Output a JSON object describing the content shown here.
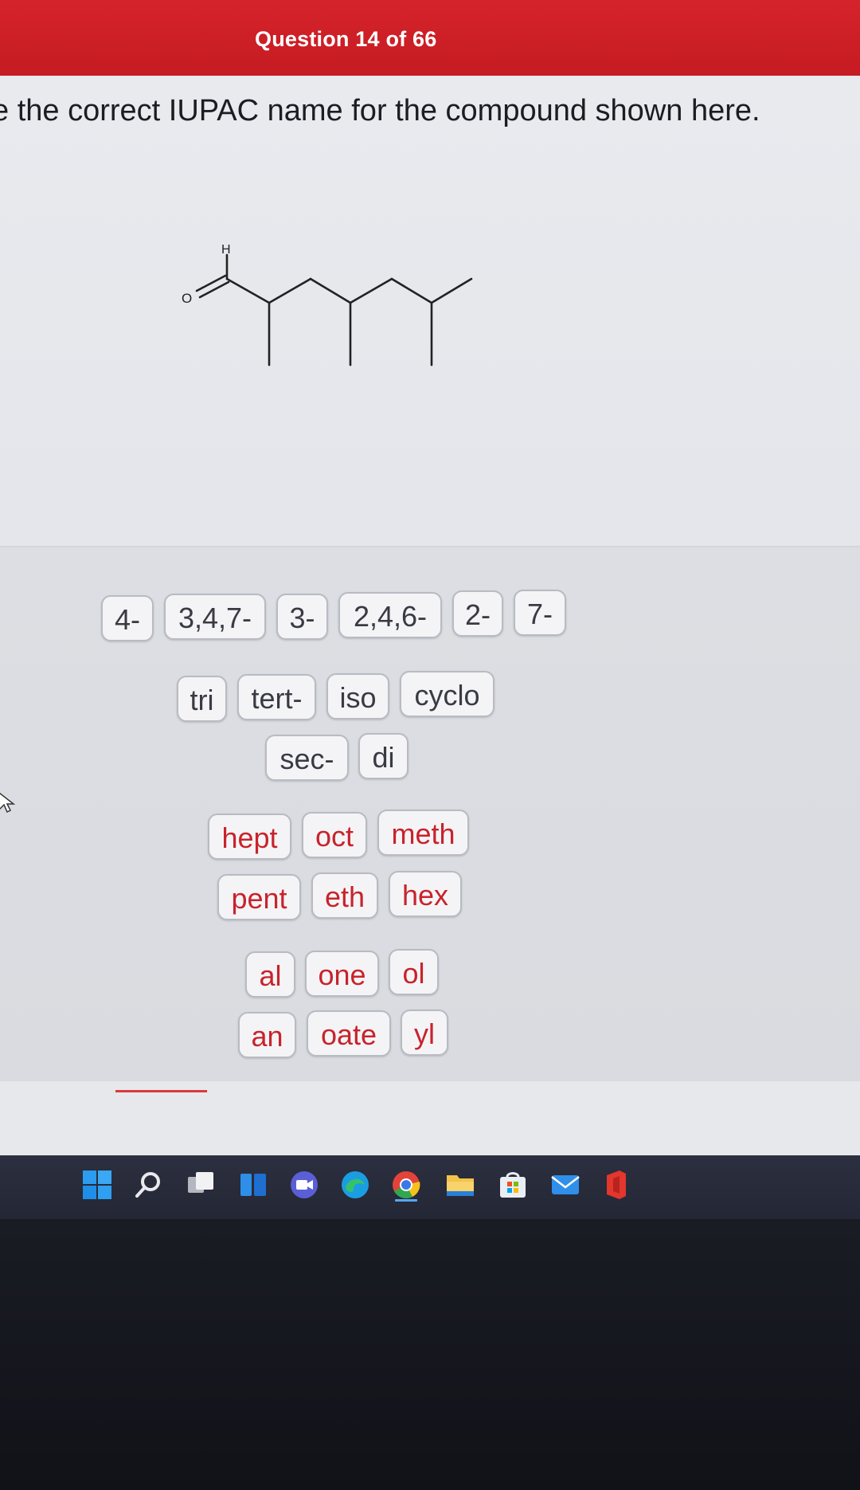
{
  "header": {
    "question_counter": "Question 14 of 66"
  },
  "prompt": {
    "text": "e the correct IUPAC name for the compound shown here."
  },
  "molecule": {
    "h_label": "H",
    "o_label": "O"
  },
  "tiles": {
    "locants": [
      "4-",
      "3,4,7-",
      "3-",
      "2,4,6-",
      "2-",
      "7-"
    ],
    "prefixes_row1": [
      "tri",
      "tert-",
      "iso",
      "cyclo"
    ],
    "prefixes_row2": [
      "sec-",
      "di"
    ],
    "roots_row1": [
      "hept",
      "oct",
      "meth"
    ],
    "roots_row2": [
      "pent",
      "eth",
      "hex"
    ],
    "suffixes_row1": [
      "al",
      "one",
      "ol"
    ],
    "suffixes_row2": [
      "an",
      "oate",
      "yl"
    ]
  },
  "colors": {
    "header_red": "#c51b22",
    "tile_red_text": "#c8232c",
    "tile_gray_text": "#3a3a44"
  },
  "taskbar": {
    "icons": [
      "windows-start-icon",
      "search-icon",
      "task-view-icon",
      "widgets-icon",
      "teams-chat-icon",
      "edge-icon",
      "chrome-icon",
      "file-explorer-icon",
      "store-icon",
      "mail-icon",
      "office-icon"
    ]
  }
}
